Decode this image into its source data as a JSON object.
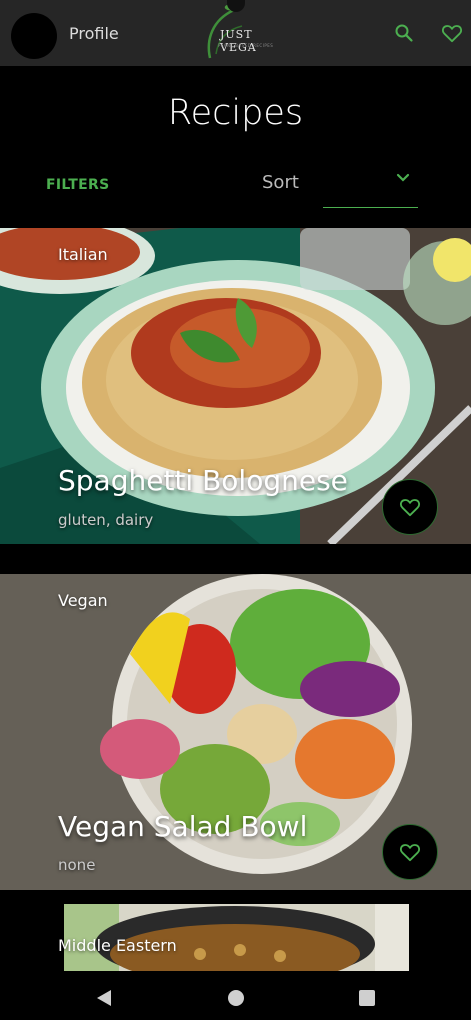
{
  "header": {
    "profile_label": "Profile",
    "logo_text": "JUST VEGA",
    "logo_subtitle": "PLANT BASED RECIPES",
    "icons": [
      "search-icon",
      "heart-icon"
    ],
    "accent_color": "#4caf50"
  },
  "page": {
    "title": "Recipes"
  },
  "controls": {
    "filters_label": "FILTERS",
    "sort_label": "Sort"
  },
  "recipes": [
    {
      "cuisine": "Italian",
      "title": "Spaghetti Bolognese",
      "allergens": "gluten, dairy"
    },
    {
      "cuisine": "Vegan",
      "title": "Vegan Salad Bowl",
      "allergens": "none"
    },
    {
      "cuisine": "Middle Eastern",
      "title": "",
      "allergens": ""
    }
  ],
  "system_nav": {
    "icons": [
      "back-icon",
      "home-icon",
      "recents-icon"
    ]
  }
}
